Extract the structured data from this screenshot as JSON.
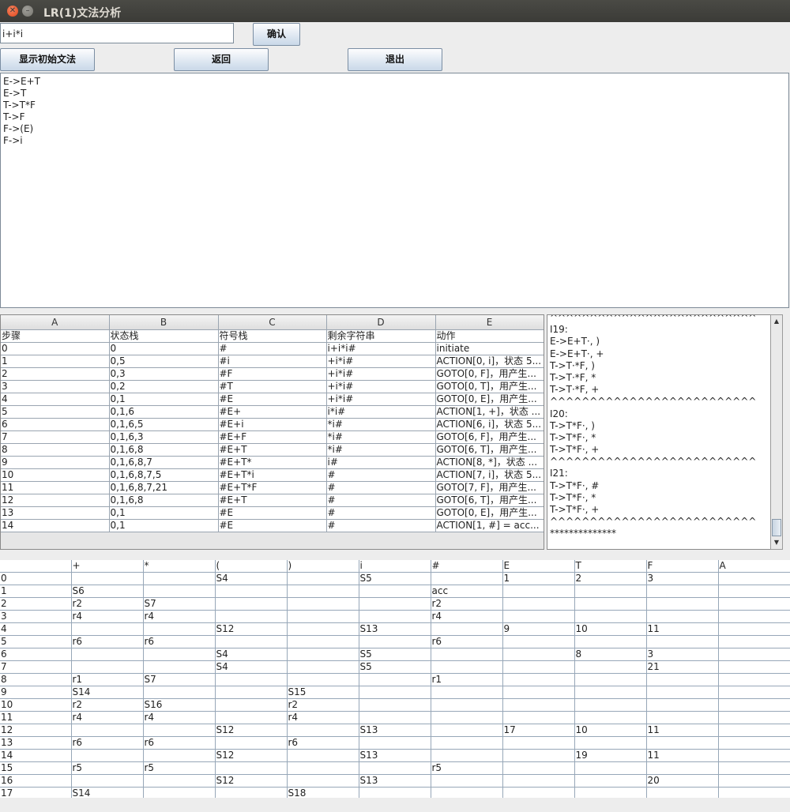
{
  "window": {
    "title": "LR(1)文法分析"
  },
  "input": {
    "value": "i+i*i"
  },
  "buttons": {
    "confirm": "确认",
    "show_grammar": "显示初始文法",
    "back": "返回",
    "exit": "退出"
  },
  "grammar": [
    "E->E+T",
    "E->T",
    "T->T*F",
    "T->F",
    "F->(E)",
    "F->i"
  ],
  "steps_table": {
    "column_letters": [
      "A",
      "B",
      "C",
      "D",
      "E"
    ],
    "header": [
      "步骤",
      "状态栈",
      "符号栈",
      "剩余字符串",
      "动作"
    ],
    "rows": [
      [
        "0",
        "0",
        "#",
        "i+i*i#",
        "initiate"
      ],
      [
        "1",
        "0,5",
        "#i",
        "+i*i#",
        "ACTION[0, i]，状态 5..."
      ],
      [
        "2",
        "0,3",
        "#F",
        "+i*i#",
        "GOTO[0, F]，用产生..."
      ],
      [
        "3",
        "0,2",
        "#T",
        "+i*i#",
        "GOTO[0, T]，用产生..."
      ],
      [
        "4",
        "0,1",
        "#E",
        "+i*i#",
        "GOTO[0, E]，用产生..."
      ],
      [
        "5",
        "0,1,6",
        "#E+",
        "i*i#",
        "ACTION[1, +]，状态 ..."
      ],
      [
        "6",
        "0,1,6,5",
        "#E+i",
        "*i#",
        "ACTION[6, i]，状态 5..."
      ],
      [
        "7",
        "0,1,6,3",
        "#E+F",
        "*i#",
        "GOTO[6, F]，用产生..."
      ],
      [
        "8",
        "0,1,6,8",
        "#E+T",
        "*i#",
        "GOTO[6, T]，用产生..."
      ],
      [
        "9",
        "0,1,6,8,7",
        "#E+T*",
        "i#",
        "ACTION[8, *]，状态 ..."
      ],
      [
        "10",
        "0,1,6,8,7,5",
        "#E+T*i",
        "#",
        "ACTION[7, i]，状态 5..."
      ],
      [
        "11",
        "0,1,6,8,7,21",
        "#E+T*F",
        "#",
        "GOTO[7, F]，用产生..."
      ],
      [
        "12",
        "0,1,6,8",
        "#E+T",
        "#",
        "GOTO[6, T]，用产生..."
      ],
      [
        "13",
        "0,1",
        "#E",
        "#",
        "GOTO[0, E]，用产生..."
      ],
      [
        "14",
        "0,1",
        "#E",
        "#",
        "ACTION[1, #] = acc..."
      ]
    ]
  },
  "item_sets": [
    "^^^^^^^^^^^^^^^^^^^^^^^^^^",
    "I19:",
    "E->E+T·, )",
    "E->E+T·, +",
    "T->T·*F, )",
    "T->T·*F, *",
    "T->T·*F, +",
    "^^^^^^^^^^^^^^^^^^^^^^^^^^",
    "I20:",
    "T->T*F·, )",
    "T->T*F·, *",
    "T->T*F·, +",
    "^^^^^^^^^^^^^^^^^^^^^^^^^^",
    "I21:",
    "T->T*F·, #",
    "T->T*F·, *",
    "T->T*F·, +",
    "^^^^^^^^^^^^^^^^^^^^^^^^^^",
    "**************"
  ],
  "lr_table": {
    "header": [
      "",
      "+",
      "*",
      "(",
      ")",
      "i",
      "#",
      "E",
      "T",
      "F",
      "A"
    ],
    "rows": [
      [
        "0",
        "",
        "",
        "S4",
        "",
        "S5",
        "",
        "1",
        "2",
        "3",
        ""
      ],
      [
        "1",
        "S6",
        "",
        "",
        "",
        "",
        "acc",
        "",
        "",
        "",
        ""
      ],
      [
        "2",
        "r2",
        "S7",
        "",
        "",
        "",
        "r2",
        "",
        "",
        "",
        ""
      ],
      [
        "3",
        "r4",
        "r4",
        "",
        "",
        "",
        "r4",
        "",
        "",
        "",
        ""
      ],
      [
        "4",
        "",
        "",
        "S12",
        "",
        "S13",
        "",
        "9",
        "10",
        "11",
        ""
      ],
      [
        "5",
        "r6",
        "r6",
        "",
        "",
        "",
        "r6",
        "",
        "",
        "",
        ""
      ],
      [
        "6",
        "",
        "",
        "S4",
        "",
        "S5",
        "",
        "",
        "8",
        "3",
        ""
      ],
      [
        "7",
        "",
        "",
        "S4",
        "",
        "S5",
        "",
        "",
        "",
        "21",
        ""
      ],
      [
        "8",
        "r1",
        "S7",
        "",
        "",
        "",
        "r1",
        "",
        "",
        "",
        ""
      ],
      [
        "9",
        "S14",
        "",
        "",
        "S15",
        "",
        "",
        "",
        "",
        "",
        ""
      ],
      [
        "10",
        "r2",
        "S16",
        "",
        "r2",
        "",
        "",
        "",
        "",
        "",
        ""
      ],
      [
        "11",
        "r4",
        "r4",
        "",
        "r4",
        "",
        "",
        "",
        "",
        "",
        ""
      ],
      [
        "12",
        "",
        "",
        "S12",
        "",
        "S13",
        "",
        "17",
        "10",
        "11",
        ""
      ],
      [
        "13",
        "r6",
        "r6",
        "",
        "r6",
        "",
        "",
        "",
        "",
        "",
        ""
      ],
      [
        "14",
        "",
        "",
        "S12",
        "",
        "S13",
        "",
        "",
        "19",
        "11",
        ""
      ],
      [
        "15",
        "r5",
        "r5",
        "",
        "",
        "",
        "r5",
        "",
        "",
        "",
        ""
      ],
      [
        "16",
        "",
        "",
        "S12",
        "",
        "S13",
        "",
        "",
        "",
        "20",
        ""
      ],
      [
        "17",
        "S14",
        "",
        "",
        "S18",
        "",
        "",
        "",
        "",
        "",
        ""
      ]
    ]
  }
}
